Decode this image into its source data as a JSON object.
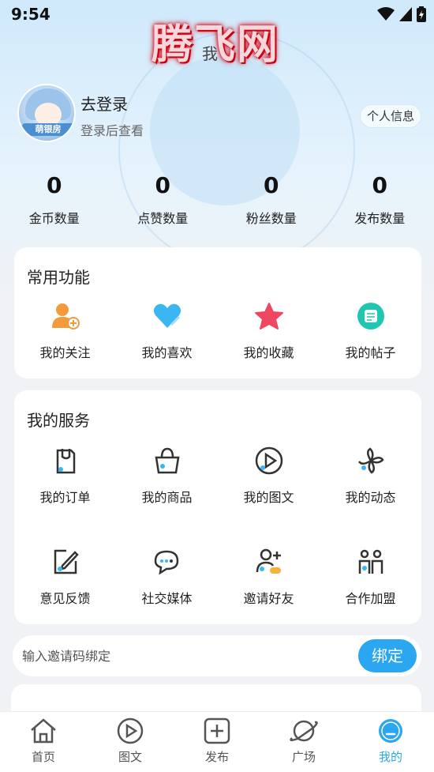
{
  "status_bar": {
    "time": "9:54"
  },
  "watermark": "腾飞网",
  "page_title": "我",
  "profile": {
    "avatar_tag": "萌银房",
    "login_title": "去登录",
    "login_sub": "登录后查看",
    "info_button": "个人信息"
  },
  "stats": [
    {
      "value": "0",
      "label": "金币数量"
    },
    {
      "value": "0",
      "label": "点赞数量"
    },
    {
      "value": "0",
      "label": "粉丝数量"
    },
    {
      "value": "0",
      "label": "发布数量"
    }
  ],
  "common": {
    "title": "常用功能",
    "items": [
      {
        "label": "我的关注",
        "icon": "user-plus-icon"
      },
      {
        "label": "我的喜欢",
        "icon": "heart-icon"
      },
      {
        "label": "我的收藏",
        "icon": "star-icon"
      },
      {
        "label": "我的帖子",
        "icon": "post-icon"
      }
    ]
  },
  "services": {
    "title": "我的服务",
    "items": [
      {
        "label": "我的订单",
        "icon": "order-icon"
      },
      {
        "label": "我的商品",
        "icon": "basket-icon"
      },
      {
        "label": "我的图文",
        "icon": "play-circle-icon"
      },
      {
        "label": "我的动态",
        "icon": "pinwheel-icon"
      },
      {
        "label": "意见反馈",
        "icon": "edit-icon"
      },
      {
        "label": "社交媒体",
        "icon": "chat-icon"
      },
      {
        "label": "邀请好友",
        "icon": "add-friend-icon"
      },
      {
        "label": "合作加盟",
        "icon": "partners-icon"
      }
    ]
  },
  "invite": {
    "placeholder": "输入邀请码绑定",
    "button": "绑定"
  },
  "bottom_nav": [
    {
      "label": "首页",
      "icon": "home-icon"
    },
    {
      "label": "图文",
      "icon": "play-circle-icon"
    },
    {
      "label": "发布",
      "icon": "plus-square-icon"
    },
    {
      "label": "广场",
      "icon": "planet-icon"
    },
    {
      "label": "我的",
      "icon": "profile-icon"
    }
  ],
  "colors": {
    "accent": "#2aa7f0",
    "orange": "#f59a3c",
    "red": "#ef4761"
  }
}
